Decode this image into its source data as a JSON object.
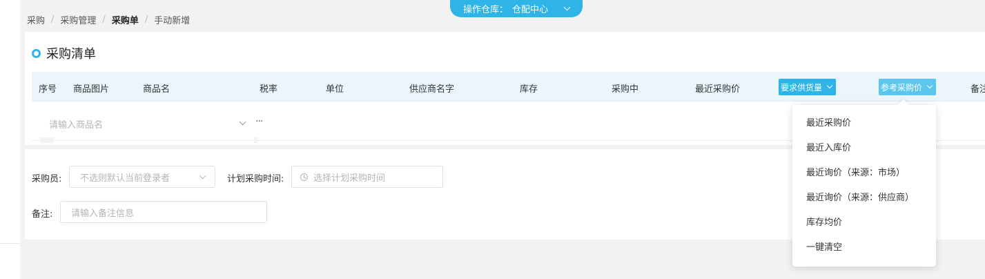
{
  "warehouse": {
    "label": "操作仓库：",
    "value": "仓配中心"
  },
  "breadcrumb": [
    "采购",
    "采购管理",
    "采购单",
    "手动新增"
  ],
  "section": {
    "title": "采购清单"
  },
  "table": {
    "columns": {
      "index": "序号",
      "image": "商品图片",
      "name": "商品名",
      "tax": "税率",
      "unit": "单位",
      "supplier": "供应商名字",
      "stock": "库存",
      "purchasing": "采购中",
      "recent_price": "最近采购价",
      "required_qty": "要求供货量",
      "ref_price": "参考采购价",
      "remark": "备注"
    },
    "row": {
      "product_placeholder": "请输入商品名",
      "more": "···"
    }
  },
  "form": {
    "buyer_label": "采购员:",
    "buyer_placeholder": "不选则默认当前登录者",
    "plan_time_label": "计划采购时间:",
    "plan_time_placeholder": "选择计划采购时间",
    "remark_label": "备注:",
    "remark_placeholder": "请输入备注信息"
  },
  "dropdown": {
    "items": [
      "最近采购价",
      "最近入库价",
      "最近询价（来源：市场）",
      "最近询价（来源：供应商）",
      "库存均价",
      "一键清空"
    ]
  },
  "colors": {
    "accent": "#2fb4e8",
    "header_bg": "#ebf6fc"
  }
}
